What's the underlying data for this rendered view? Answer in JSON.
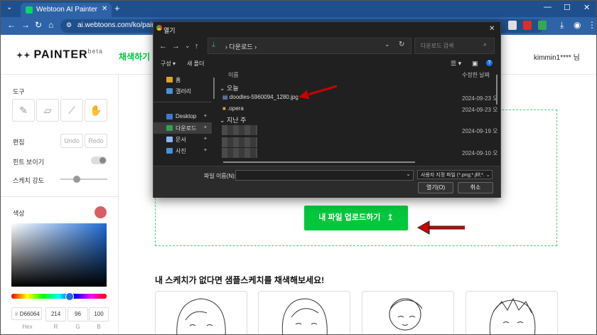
{
  "browser": {
    "tab_title": "Webtoon AI Painter",
    "tab_close": "✕",
    "new_tab": "+",
    "url": "ai.webtoons.com/ko/painter/",
    "controls": {
      "minimize": "—",
      "maximize": "☐",
      "close": "✕"
    }
  },
  "header": {
    "logo": "PAINTER",
    "logo_badge": "beta",
    "menu_colorize": "채색하기",
    "user_name": "kimmin1**** 님"
  },
  "sidebar": {
    "tools_title": "도구",
    "tools": [
      "brush-icon",
      "eraser-icon",
      "eyedropper-icon",
      "hand-icon"
    ],
    "edit_title": "편집",
    "undo_label": "Undo",
    "redo_label": "Redo",
    "hint_label": "힌트 보이기",
    "sketch_strength_label": "스케치 강도",
    "color_title": "색상",
    "current_color": "#d66064",
    "hex_prefix": "#",
    "hex_value": "D66064",
    "r_value": "214",
    "g_value": "96",
    "b_value": "100",
    "hex_label": "Hex",
    "r_label": "R",
    "g_label": "G",
    "b_label": "B"
  },
  "main": {
    "upload_button": "내 파일 업로드하기",
    "upload_icon": "↥",
    "sample_title": "내 스케치가 없다면 샘플스케치를 채색해보세요!"
  },
  "dialog": {
    "title": "열기",
    "close": "✕",
    "path_folder": "다운로드",
    "path_chevron": "›",
    "search_placeholder": "다운로드 검색",
    "organize_label": "구성",
    "new_folder_label": "새 폴더",
    "nav_items": [
      {
        "label": "홈",
        "color": "#e0a030"
      },
      {
        "label": "갤러리",
        "color": "#4a90d9"
      },
      {
        "label": "Desktop",
        "color": "#3a7bd5"
      },
      {
        "label": "다운로드",
        "color": "#2fa44f"
      },
      {
        "label": "문서",
        "color": "#8ab4f8"
      },
      {
        "label": "사진",
        "color": "#4a90d9"
      }
    ],
    "pin_glyph": "📌",
    "col_name": "이름",
    "col_date": "수정한 날짜",
    "group_today": "오늘",
    "group_last_week": "지난 주",
    "files": [
      {
        "name": "doodles-5960094_1280.jpg",
        "date": "2024-09-23 오"
      },
      {
        "name": ".opera",
        "date": "2024-09-23 오"
      }
    ],
    "last_week_dates": [
      "2024-09-19 오",
      "2024-09-10 오"
    ],
    "filename_label": "파일 이름(N):",
    "filetype_label": "사용자 지정 파일 (*.png;*.jfif;*.",
    "open_button": "열기(O)",
    "cancel_button": "취소"
  },
  "colors": {
    "accent_green": "#00c73c",
    "browser_blue": "#2e63a8",
    "annotation_red": "#cc0000"
  }
}
